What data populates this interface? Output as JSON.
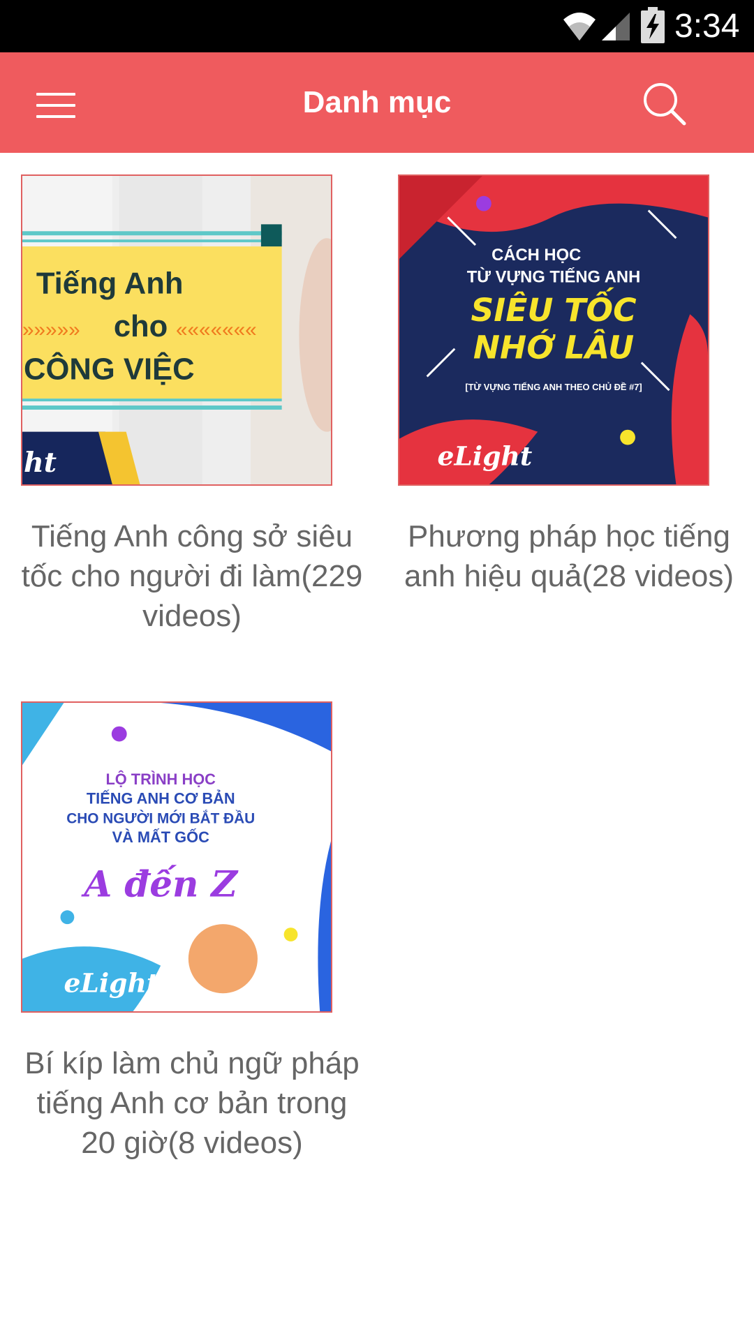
{
  "status_bar": {
    "time": "3:34"
  },
  "app_bar": {
    "title": "Danh mục"
  },
  "categories": [
    {
      "title": "Tiếng Anh công sở siêu tốc cho người đi làm(229 videos)",
      "thumb": {
        "line1": "Tiếng Anh",
        "line2": "cho",
        "line3": "CÔNG VIỆC",
        "logo": "ht",
        "arrows_left": "»»»»»",
        "arrows_right": "«««««««"
      }
    },
    {
      "title": "Phương pháp học tiếng anh hiệu quả(28 videos)",
      "thumb": {
        "line1": "CÁCH HỌC",
        "line2": "TỪ VỰNG TIẾNG ANH",
        "line3": "SIÊU TỐC",
        "line4": "NHỚ LÂU",
        "line5": "[TỪ VỰNG TIẾNG ANH THEO CHỦ ĐỀ #7]",
        "logo": "eLight"
      }
    },
    {
      "title": "Bí kíp làm chủ ngữ pháp tiếng Anh cơ bản trong 20 giờ(8 videos)",
      "thumb": {
        "line1": "LỘ TRÌNH HỌC",
        "line2": "TIẾNG ANH CƠ BẢN",
        "line3": "CHO NGƯỜI MỚI BẮT ĐẦU",
        "line4": "VÀ MẤT GỐC",
        "line5": "A đến Z",
        "logo": "eLight"
      }
    }
  ],
  "colors": {
    "app_bar": "#ef5b5e",
    "status_bar": "#000000",
    "title_text": "#666666",
    "thumb_border": "#e06060"
  },
  "icons": {
    "menu": "hamburger-icon",
    "search": "search-icon",
    "wifi": "wifi-icon",
    "signal": "signal-icon",
    "battery": "battery-charging-icon"
  }
}
